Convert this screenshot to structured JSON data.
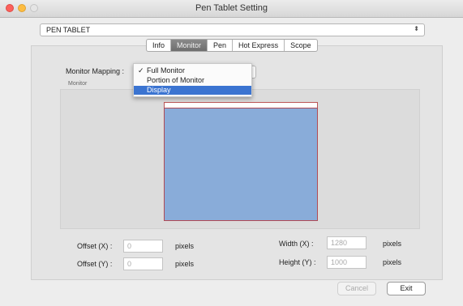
{
  "window": {
    "title": "Pen Tablet Setting"
  },
  "device_select": {
    "value": "PEN TABLET"
  },
  "tabs": [
    {
      "label": "Info"
    },
    {
      "label": "Monitor",
      "active": true
    },
    {
      "label": "Pen"
    },
    {
      "label": "Hot Express"
    },
    {
      "label": "Scope"
    }
  ],
  "monitor_mapping": {
    "label": "Monitor Mapping :",
    "options": [
      {
        "label": "Full Monitor",
        "check": "✓"
      },
      {
        "label": "Portion of Monitor",
        "check": ""
      },
      {
        "label": "Display",
        "check": "",
        "selected": true
      }
    ]
  },
  "monitor_group_label": "Monitor",
  "offset_x": {
    "label": "Offset (X) :",
    "value": "0",
    "unit": "pixels"
  },
  "offset_y": {
    "label": "Offset (Y) :",
    "value": "0",
    "unit": "pixels"
  },
  "width": {
    "label": "Width  (X) :",
    "value": "1280",
    "unit": "pixels"
  },
  "height": {
    "label": "Height (Y) :",
    "value": "1000",
    "unit": "pixels"
  },
  "buttons": {
    "cancel": "Cancel",
    "exit": "Exit"
  },
  "colors": {
    "screen_fill": "#89acd9",
    "screen_border": "#b04a55",
    "menu_highlight": "#3b74d1"
  }
}
